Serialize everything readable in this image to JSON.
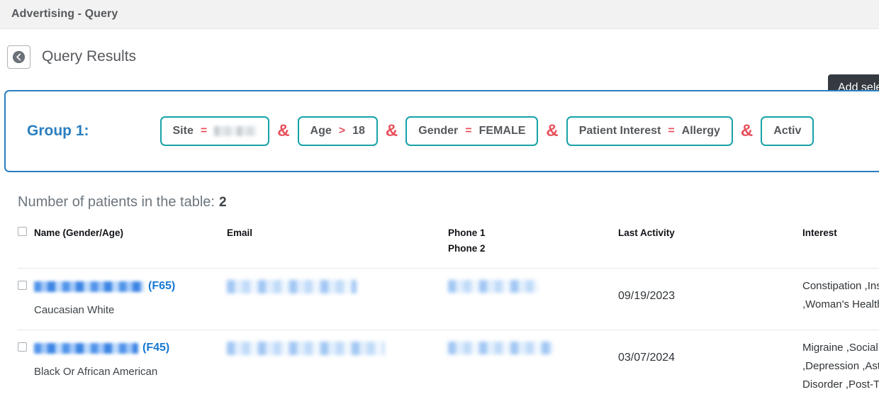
{
  "titlebar": {
    "title": "Advertising - Query"
  },
  "subheader": {
    "back_icon": "circle-chevron-left-icon",
    "page_title": "Query Results",
    "add_selected_label": "Add sele"
  },
  "query_group": {
    "label": "Group 1:",
    "conjunction": "&",
    "border_color": "#2a7ec0",
    "chip_border_color": "#17a2a8",
    "operator_color": "#e8505b",
    "chips": [
      {
        "field": "Site",
        "op": "=",
        "value": "",
        "value_redacted": true
      },
      {
        "field": "Age",
        "op": ">",
        "value": "18",
        "value_redacted": false
      },
      {
        "field": "Gender",
        "op": "=",
        "value": "FEMALE",
        "value_redacted": false
      },
      {
        "field": "Patient Interest",
        "op": "=",
        "value": "Allergy",
        "value_redacted": false
      },
      {
        "field": "Activ",
        "op": "",
        "value": "",
        "value_redacted": false
      }
    ]
  },
  "results": {
    "count_label": "Number of patients in the table:",
    "count_value": "2",
    "columns": [
      "Name (Gender/Age)",
      "Email",
      "Phone 1",
      "Phone 2",
      "Last Activity",
      "Interest"
    ],
    "rows": [
      {
        "name_redacted": true,
        "gender_age": "(F65)",
        "race": "Caucasian White",
        "email_redacted": true,
        "phone_redacted": true,
        "last_activity": "09/19/2023",
        "interest": "Constipation ,Ins\n,Woman's Health"
      },
      {
        "name_redacted": true,
        "gender_age": "(F45)",
        "race": "Black Or African American",
        "email_redacted": true,
        "phone_redacted": true,
        "last_activity": "03/07/2024",
        "interest": "Migraine ,Social ,\n,Depression ,Asth\nDisorder ,Post-Tr"
      }
    ]
  }
}
